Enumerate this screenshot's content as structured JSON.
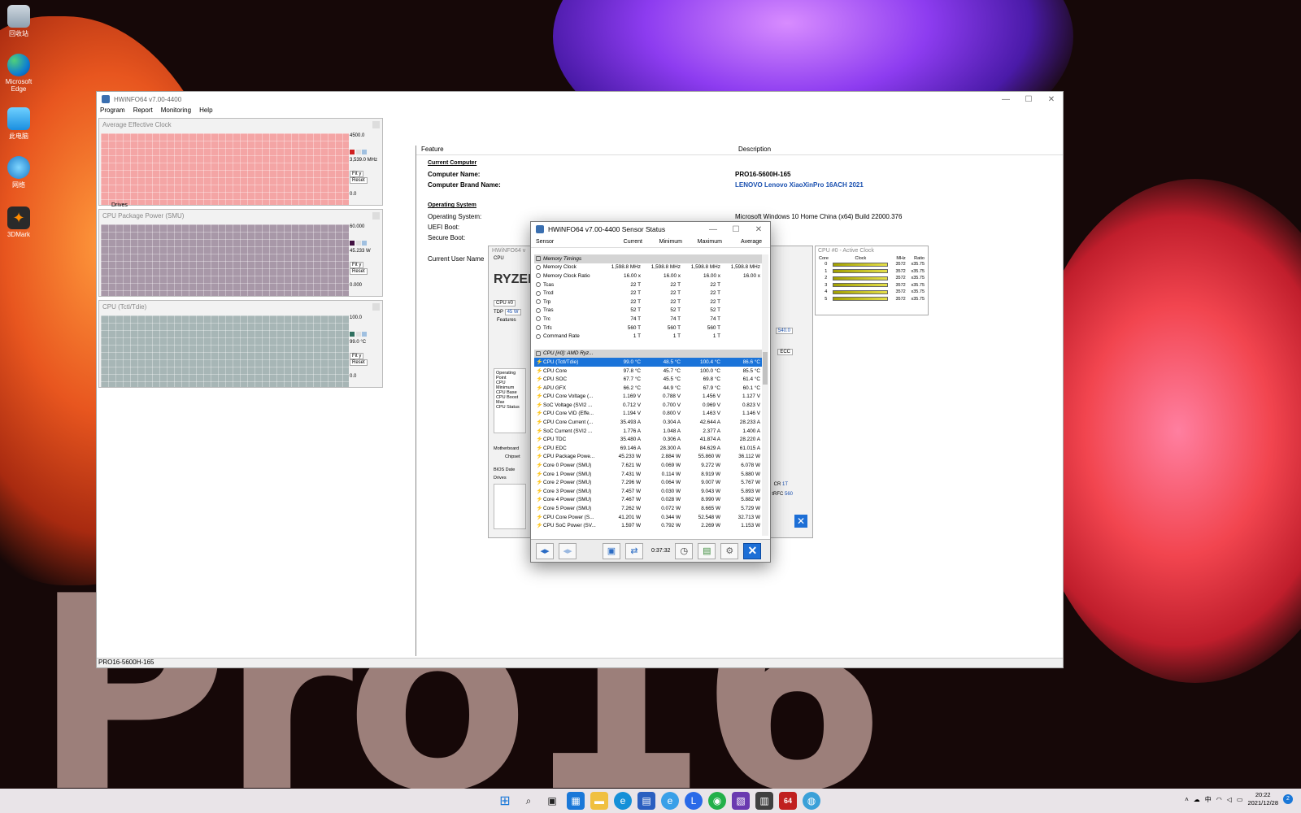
{
  "desktop": {
    "icons": [
      {
        "label": "回收站"
      },
      {
        "label": "Microsoft Edge"
      },
      {
        "label": "此电脑"
      },
      {
        "label": "网络"
      },
      {
        "label": "3DMark"
      }
    ],
    "wallpaper_text": "Pro16"
  },
  "main_window": {
    "title": "HWiNFO64 v7.00-4400",
    "menu": [
      "Program",
      "Report",
      "Monitoring",
      "Help"
    ],
    "status": "PRO16-5600H-165",
    "graphs": [
      {
        "title": "Average Effective Clock",
        "max": "4500.0",
        "current": "3,539.0 MHz",
        "min": "0.0",
        "fit": "Fit y",
        "reset": "Reset",
        "color": "#f4a5a5"
      },
      {
        "title": "CPU Package Power (SMU)",
        "max": "60.000",
        "current": "45.233 W",
        "min": "0.000",
        "fit": "Fit y",
        "reset": "Reset",
        "color": "#a898a8"
      },
      {
        "title": "CPU (Tctl/Tdie)",
        "max": "100.0",
        "current": "99.0 °C",
        "min": "0.0",
        "fit": "Fit y",
        "reset": "Reset",
        "color": "#a7b6b6"
      }
    ],
    "tree_item": "Drives",
    "feature_header": "Feature",
    "description_header": "Description",
    "features": [
      {
        "name": "Current Computer",
        "value": "",
        "section": true
      },
      {
        "name": "Computer Name:",
        "value": "PRO16-5600H-165"
      },
      {
        "name": "Computer Brand Name:",
        "value": "LENOVO Lenovo XiaoXinPro 16ACH 2021"
      },
      {
        "name": "Operating System",
        "value": "",
        "section": true
      },
      {
        "name": "Operating System:",
        "value": "Microsoft Windows 10 Home China (x64) Build 22000.376"
      },
      {
        "name": "UEFI Boot:",
        "value": ""
      },
      {
        "name": "Secure Boot:",
        "value": ""
      },
      {
        "name": "Current User Name",
        "value": ""
      }
    ]
  },
  "clock_window": {
    "title": "CPU #0 - Active Clock",
    "headers": [
      "Core",
      "Clock",
      "MHz",
      "Ratio"
    ],
    "rows": [
      {
        "core": "0",
        "mhz": "3572",
        "ratio": "x35.75"
      },
      {
        "core": "1",
        "mhz": "3572",
        "ratio": "x35.75"
      },
      {
        "core": "2",
        "mhz": "3572",
        "ratio": "x35.75"
      },
      {
        "core": "3",
        "mhz": "3572",
        "ratio": "x35.75"
      },
      {
        "core": "4",
        "mhz": "3572",
        "ratio": "x35.75"
      },
      {
        "core": "5",
        "mhz": "3572",
        "ratio": "x35.75"
      }
    ]
  },
  "summary_window": {
    "title": "HWiNFO64 v",
    "cpu_label": "CPU",
    "cpu_select": "CPU #0",
    "tdp_label": "TDP",
    "tdp_value": "45 W",
    "features_label": "Features",
    "op_point": "Operating Point",
    "op_rows": [
      "CPU Minimum",
      "CPU Base",
      "CPU Boost Max",
      "CPU Status"
    ],
    "motherboard": "Motherboard",
    "chipset": "Chipset",
    "bios": "BIOS Date",
    "drives": "Drives",
    "ecc": "ECC",
    "cr": "CR",
    "cr_val": "1T",
    "trfc": "tRFC",
    "trfc_val": "560",
    "video_val": "540.0"
  },
  "sensor_window": {
    "title": "HWiNFO64 v7.00-4400 Sensor Status",
    "headers": [
      "Sensor",
      "Current",
      "Minimum",
      "Maximum",
      "Average"
    ],
    "elapsed": "0:37:32",
    "rows": [
      {
        "name": "Memory Timings",
        "group": true
      },
      {
        "name": "Memory Clock",
        "cur": "1,598.8 MHz",
        "min": "1,598.8 MHz",
        "max": "1,598.8 MHz",
        "avg": "1,598.8 MHz",
        "icon": "dot"
      },
      {
        "name": "Memory Clock Ratio",
        "cur": "16.00 x",
        "min": "16.00 x",
        "max": "16.00 x",
        "avg": "16.00 x",
        "icon": "dot"
      },
      {
        "name": "Tcas",
        "cur": "22 T",
        "min": "22 T",
        "max": "22 T",
        "avg": "",
        "icon": "dot"
      },
      {
        "name": "Trcd",
        "cur": "22 T",
        "min": "22 T",
        "max": "22 T",
        "avg": "",
        "icon": "dot"
      },
      {
        "name": "Trp",
        "cur": "22 T",
        "min": "22 T",
        "max": "22 T",
        "avg": "",
        "icon": "dot"
      },
      {
        "name": "Tras",
        "cur": "52 T",
        "min": "52 T",
        "max": "52 T",
        "avg": "",
        "icon": "dot"
      },
      {
        "name": "Trc",
        "cur": "74 T",
        "min": "74 T",
        "max": "74 T",
        "avg": "",
        "icon": "dot"
      },
      {
        "name": "Trfc",
        "cur": "560 T",
        "min": "560 T",
        "max": "560 T",
        "avg": "",
        "icon": "dot"
      },
      {
        "name": "Command Rate",
        "cur": "1 T",
        "min": "1 T",
        "max": "1 T",
        "avg": "",
        "icon": "dot"
      },
      {
        "name": "",
        "spacer": true
      },
      {
        "name": "CPU [#0]: AMD Ryz...",
        "group": true
      },
      {
        "name": "CPU (Tctl/Tdie)",
        "cur": "99.0 °C",
        "min": "48.5 °C",
        "max": "100.4 °C",
        "avg": "86.6 °C",
        "icon": "bolt",
        "selected": true
      },
      {
        "name": "CPU Core",
        "cur": "97.8 °C",
        "min": "45.7 °C",
        "max": "100.0 °C",
        "avg": "85.5 °C",
        "icon": "bolt"
      },
      {
        "name": "CPU SOC",
        "cur": "67.7 °C",
        "min": "45.5 °C",
        "max": "69.8 °C",
        "avg": "61.4 °C",
        "icon": "bolt"
      },
      {
        "name": "APU GFX",
        "cur": "66.2 °C",
        "min": "44.9 °C",
        "max": "67.9 °C",
        "avg": "60.1 °C",
        "icon": "bolt"
      },
      {
        "name": "CPU Core Voltage (...",
        "cur": "1.169 V",
        "min": "0.788 V",
        "max": "1.456 V",
        "avg": "1.127 V",
        "icon": "bolt"
      },
      {
        "name": "SoC Voltage (SVI2 ...",
        "cur": "0.712 V",
        "min": "0.700 V",
        "max": "0.969 V",
        "avg": "0.823 V",
        "icon": "bolt"
      },
      {
        "name": "CPU Core VID (Effe...",
        "cur": "1.194 V",
        "min": "0.800 V",
        "max": "1.463 V",
        "avg": "1.146 V",
        "icon": "bolt"
      },
      {
        "name": "CPU Core Current (...",
        "cur": "35.493 A",
        "min": "0.304 A",
        "max": "42.644 A",
        "avg": "28.233 A",
        "icon": "bolt"
      },
      {
        "name": "SoC Current (SVI2 ...",
        "cur": "1.776 A",
        "min": "1.048 A",
        "max": "2.377 A",
        "avg": "1.400 A",
        "icon": "bolt"
      },
      {
        "name": "CPU TDC",
        "cur": "35.480 A",
        "min": "0.306 A",
        "max": "41.874 A",
        "avg": "28.220 A",
        "icon": "bolt"
      },
      {
        "name": "CPU EDC",
        "cur": "69.146 A",
        "min": "28.300 A",
        "max": "84.629 A",
        "avg": "61.015 A",
        "icon": "bolt"
      },
      {
        "name": "CPU Package Powe...",
        "cur": "45.233 W",
        "min": "2.884 W",
        "max": "55.860 W",
        "avg": "36.112 W",
        "icon": "bolt"
      },
      {
        "name": "Core 0 Power (SMU)",
        "cur": "7.621 W",
        "min": "0.069 W",
        "max": "9.272 W",
        "avg": "6.078 W",
        "icon": "bolt"
      },
      {
        "name": "Core 1 Power (SMU)",
        "cur": "7.431 W",
        "min": "0.114 W",
        "max": "8.919 W",
        "avg": "5.880 W",
        "icon": "bolt"
      },
      {
        "name": "Core 2 Power (SMU)",
        "cur": "7.296 W",
        "min": "0.064 W",
        "max": "9.007 W",
        "avg": "5.767 W",
        "icon": "bolt"
      },
      {
        "name": "Core 3 Power (SMU)",
        "cur": "7.457 W",
        "min": "0.030 W",
        "max": "9.043 W",
        "avg": "5.893 W",
        "icon": "bolt"
      },
      {
        "name": "Core 4 Power (SMU)",
        "cur": "7.467 W",
        "min": "0.028 W",
        "max": "8.990 W",
        "avg": "5.882 W",
        "icon": "bolt"
      },
      {
        "name": "Core 5 Power (SMU)",
        "cur": "7.262 W",
        "min": "0.072 W",
        "max": "8.665 W",
        "avg": "5.729 W",
        "icon": "bolt"
      },
      {
        "name": "CPU Core Power (S...",
        "cur": "41.201 W",
        "min": "0.344 W",
        "max": "52.548 W",
        "avg": "32.713 W",
        "icon": "bolt"
      },
      {
        "name": "CPU SoC Power (SV...",
        "cur": "1.597 W",
        "min": "0.792 W",
        "max": "2.269 W",
        "avg": "1.153 W",
        "icon": "bolt"
      }
    ]
  },
  "taskbar": {
    "ime": "中",
    "time": "20:22",
    "date": "2021/12/28",
    "badge": "2",
    "app_hwinfo": "64"
  }
}
